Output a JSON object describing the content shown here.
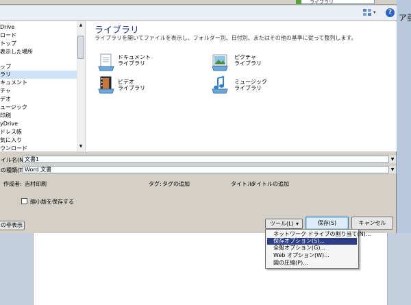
{
  "background": {
    "doc_label": "ア亜"
  },
  "address_bar": {
    "text": "ライブラリ"
  },
  "toolbar": {
    "view_icon": "view-options-icon",
    "help_icon": "help-icon",
    "help_glyph": "?"
  },
  "nav": {
    "items": [
      {
        "label": "Drive"
      },
      {
        "label": "ロード"
      },
      {
        "label": "トップ"
      },
      {
        "label": "表示した場所"
      },
      {
        "label": ""
      },
      {
        "label": "ップ"
      },
      {
        "label": "ラリ"
      },
      {
        "label": "キュメント"
      },
      {
        "label": "チャ"
      },
      {
        "label": "デオ"
      },
      {
        "label": "ュージック"
      },
      {
        "label": "印刷"
      },
      {
        "label": "yDrive"
      },
      {
        "label": "ドレス帳"
      },
      {
        "label": "気に入り"
      },
      {
        "label": "ウンロード"
      }
    ]
  },
  "content": {
    "title": "ライブラリ",
    "description": "ライブラリを開いてファイルを表示し、フォルダー別、日付別、またはその他の基準に従って整列します。",
    "libraries": [
      {
        "name": "ドキュメント",
        "sub": "ライブラリ",
        "icon": "documents-library-icon"
      },
      {
        "name": "ピクチャ",
        "sub": "ライブラリ",
        "icon": "pictures-library-icon"
      },
      {
        "name": "ビデオ",
        "sub": "ライブラリ",
        "icon": "videos-library-icon"
      },
      {
        "name": "ミュージック",
        "sub": "ライブラリ",
        "icon": "music-library-icon"
      }
    ]
  },
  "form": {
    "filename_label": "イル名(N):",
    "filename_value": "文書1",
    "filetype_label": "の種類(T):",
    "filetype_value": "Word 文書",
    "author_label": "作成者:",
    "author_value": "吉村印刷",
    "tags_label": "タグ:",
    "tags_value": "タグの追加",
    "title_label": "タイトル:",
    "title_value": "タイトルの追加",
    "thumbnail_label": "縮小版を保存する"
  },
  "buttons": {
    "hide_folders": "の非表示",
    "tools": "ツール(L)",
    "tools_arrow": "▾",
    "save": "保存(S)",
    "cancel": "キャンセル"
  },
  "tools_menu": {
    "items": [
      {
        "label": "ネットワーク ドライブの割り当て(N)...",
        "highlighted": false
      },
      {
        "label": "保存オプション(S)...",
        "highlighted": true
      },
      {
        "label": "全般オプション(G)...",
        "highlighted": false
      },
      {
        "label": "Web オプション(W)...",
        "highlighted": false
      },
      {
        "label": "図の圧縮(P)...",
        "highlighted": false
      }
    ]
  },
  "colors": {
    "accent": "#2b3e86",
    "title_blue": "#1e3287",
    "selection": "#cfe3f7"
  }
}
